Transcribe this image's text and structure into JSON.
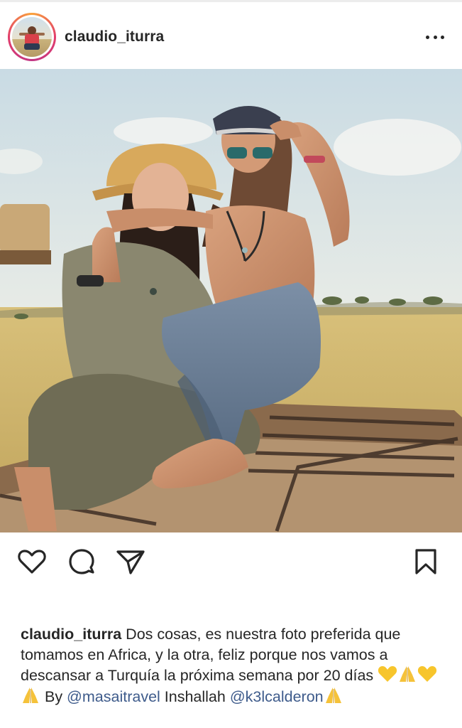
{
  "post": {
    "author": {
      "username": "claudio_iturra",
      "avatar_icon": "profile-avatar-icon"
    },
    "photo": {
      "icon": "post-photo"
    },
    "caption": {
      "username": "claudio_iturra",
      "text_1": " Dos cosas, es nuestra foto preferida que tomamos en Africa, y la otra, feliz porque nos vamos a descansar a Turquía la próxima semana por 20 días ",
      "text_2": " By ",
      "mention_1": "@masaitravel",
      "text_3": " Inshallah ",
      "mention_2": "@k3lcalderon",
      "emojis": [
        "yellow-heart",
        "folded-hands",
        "yellow-heart",
        "folded-hands",
        "folded-hands"
      ]
    }
  },
  "actions": {
    "icons": [
      "heart-icon",
      "comment-icon",
      "share-icon",
      "bookmark-icon"
    ]
  },
  "colors": {
    "text": "#262626",
    "mention": "#3e5b8b",
    "ring_start": "#f9a23c",
    "ring_end": "#c13584"
  }
}
